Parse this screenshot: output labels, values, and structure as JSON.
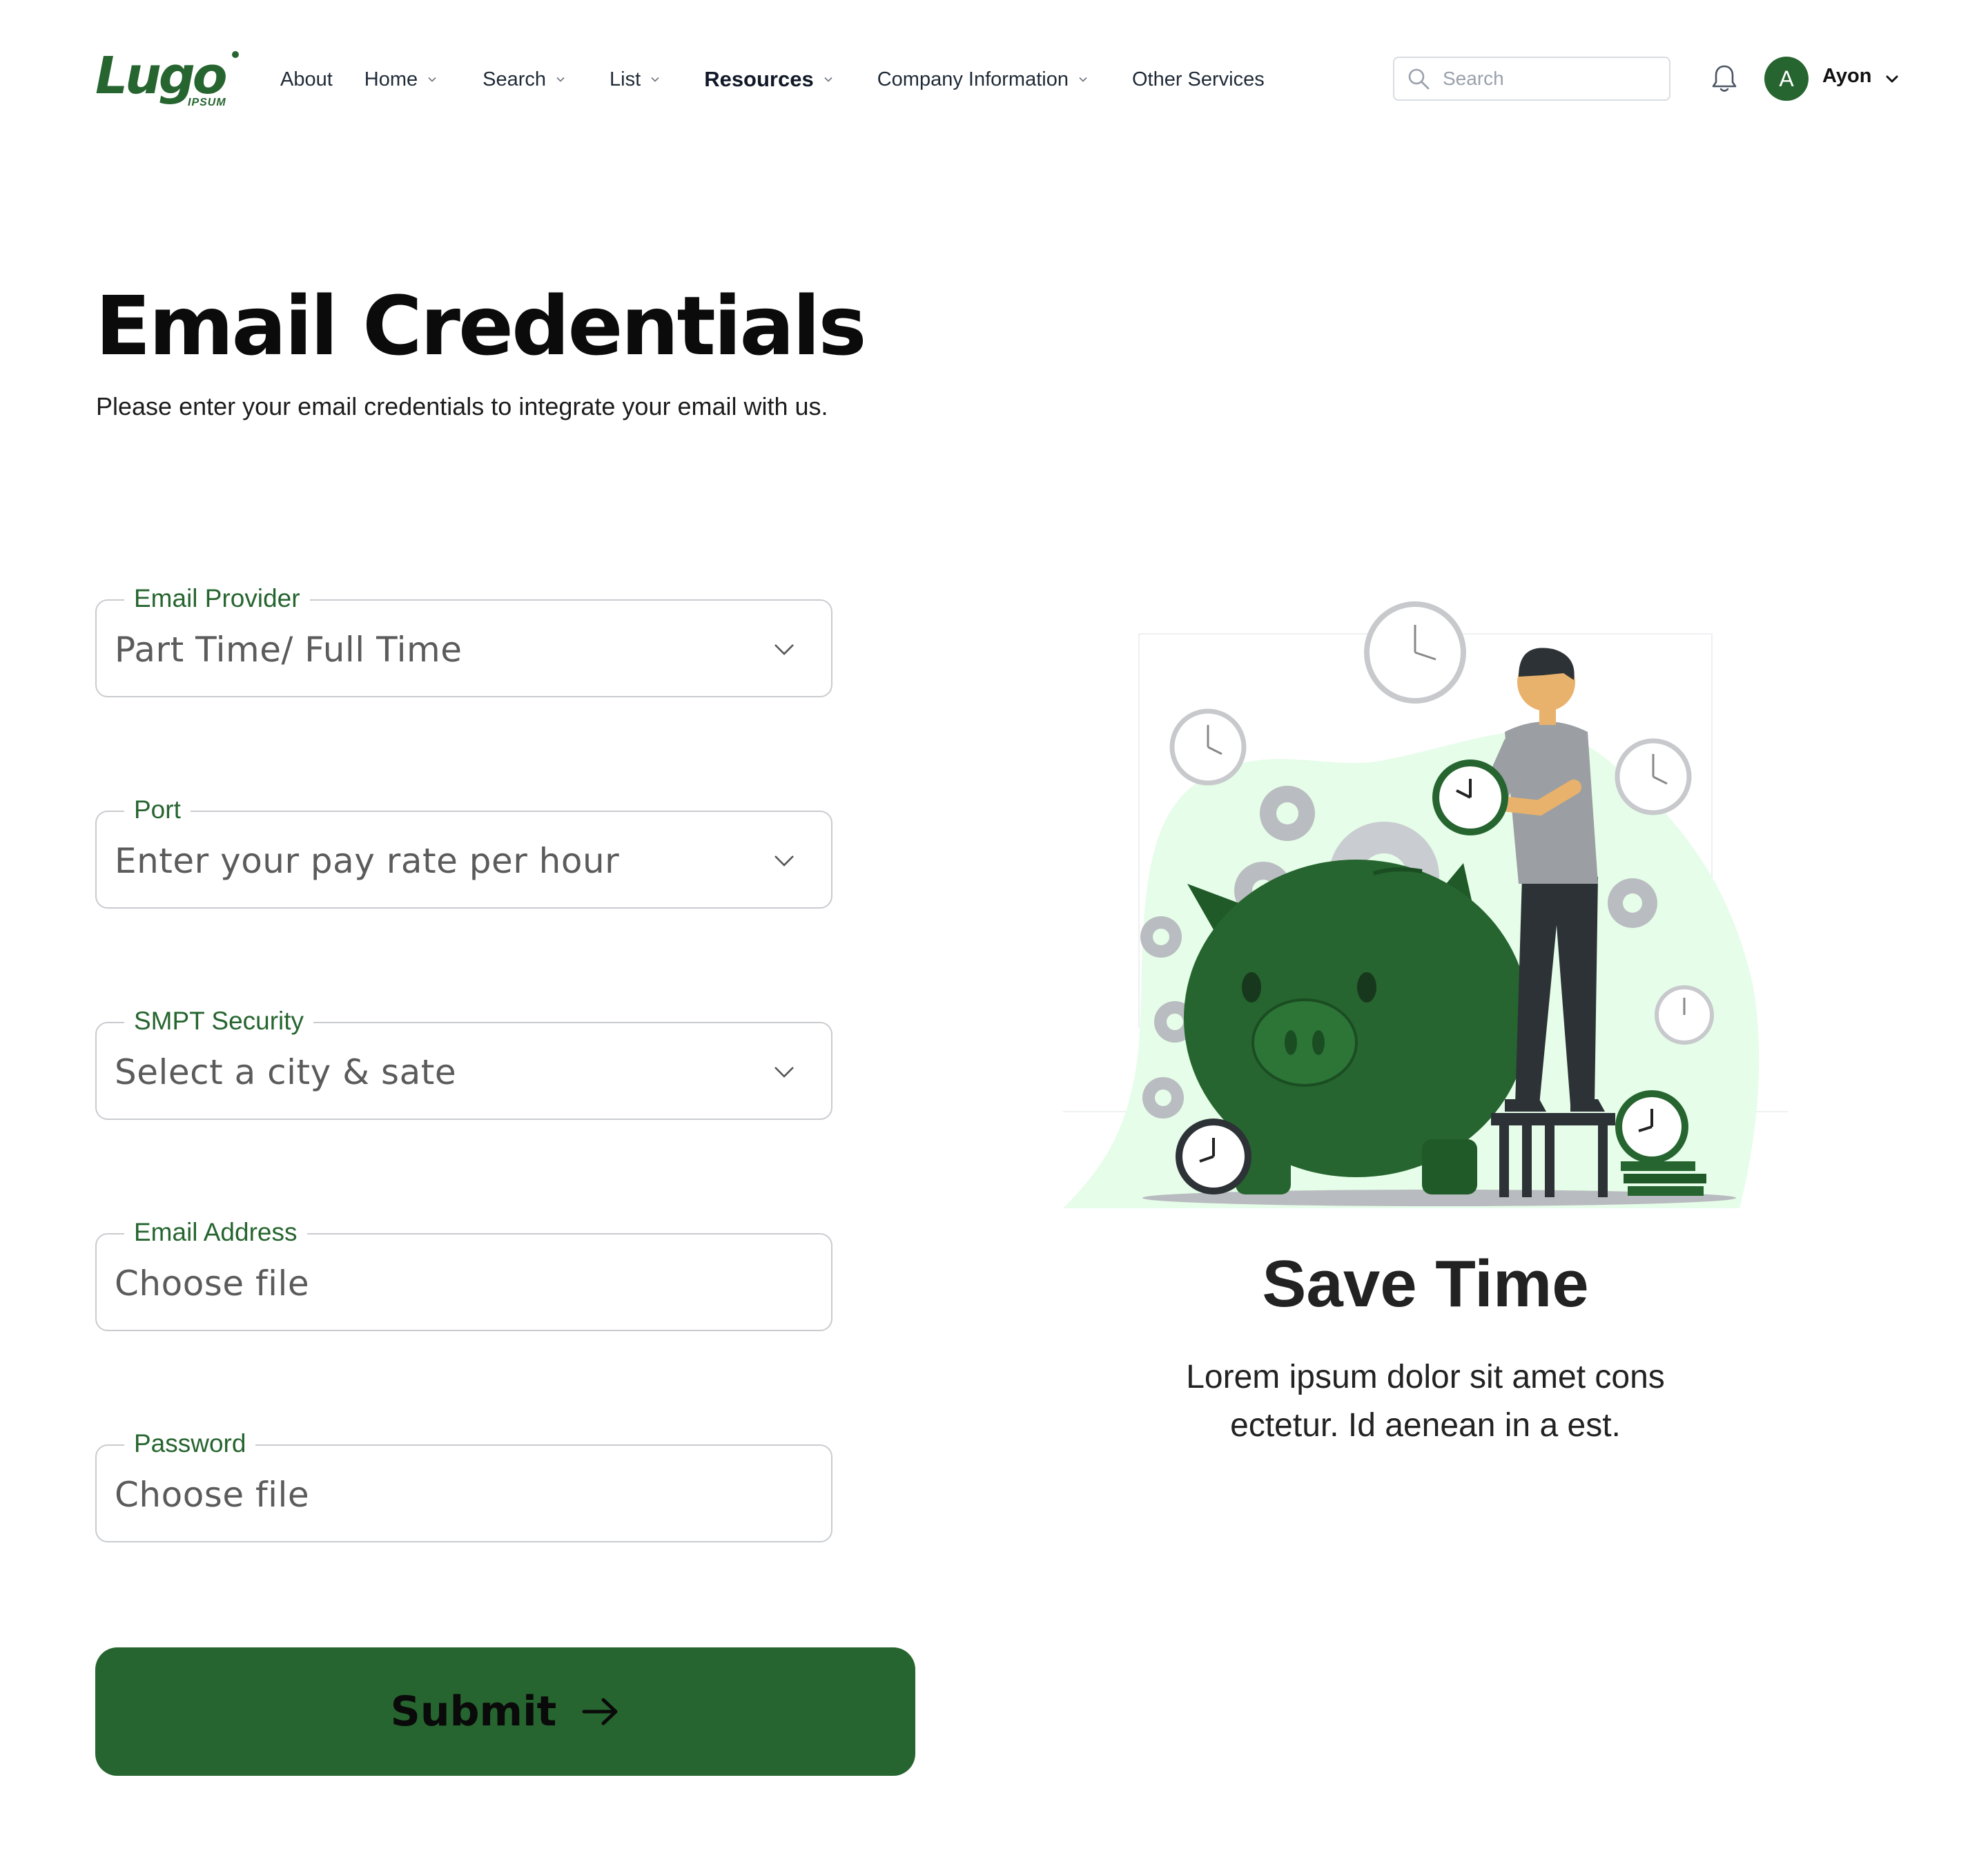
{
  "brand": {
    "logo_text": "Lugo",
    "logo_subtext": "IPSUM"
  },
  "nav": {
    "items": [
      {
        "label": "About",
        "has_dropdown": false
      },
      {
        "label": "Home",
        "has_dropdown": true
      },
      {
        "label": "Search",
        "has_dropdown": true
      },
      {
        "label": "List",
        "has_dropdown": true
      },
      {
        "label": "Resources",
        "has_dropdown": true,
        "active": true
      },
      {
        "label": "Company Information",
        "has_dropdown": true
      },
      {
        "label": "Other Services",
        "has_dropdown": false
      }
    ],
    "search_placeholder": "Search",
    "user": {
      "initial": "A",
      "name": "Ayon"
    }
  },
  "page": {
    "title": "Email Credentials",
    "subtitle": "Please enter your email credentials to integrate your email with us."
  },
  "form": {
    "fields": [
      {
        "label": "Email Provider",
        "value": "Part Time/ Full Time",
        "type": "select"
      },
      {
        "label": "Port",
        "value": "Enter your pay rate per hour",
        "type": "select"
      },
      {
        "label": "SMPT Security",
        "value": "Select a city & sate",
        "type": "select"
      },
      {
        "label": "Email Address",
        "value": "Choose file",
        "type": "input"
      },
      {
        "label": "Password",
        "value": "Choose file",
        "type": "input"
      }
    ],
    "submit_label": "Submit"
  },
  "promo": {
    "title": "Save Time",
    "text": "Lorem ipsum dolor sit amet cons ectetur. Id aenean in a est."
  },
  "colors": {
    "brand_green": "#26652f",
    "light_green": "#e6fde9",
    "text_dark": "#111111"
  },
  "icons": [
    "search-icon",
    "bell-icon",
    "chevron-down-icon",
    "arrow-right-icon"
  ]
}
